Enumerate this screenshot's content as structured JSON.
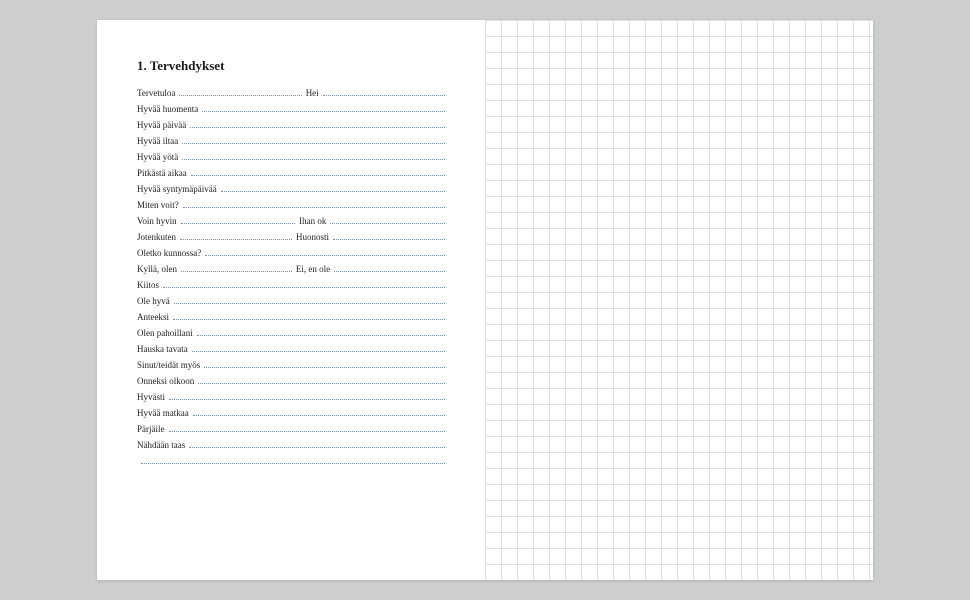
{
  "heading": "1. Tervehdykset",
  "rows": [
    {
      "cols": [
        {
          "w": "Tervetuloa"
        },
        {
          "w": "Hei"
        }
      ]
    },
    {
      "cols": [
        {
          "w": "Hyvää huomenta"
        }
      ]
    },
    {
      "cols": [
        {
          "w": "Hyvää päivää"
        }
      ]
    },
    {
      "cols": [
        {
          "w": "Hyvää iltaa"
        }
      ]
    },
    {
      "cols": [
        {
          "w": "Hyvää yötä"
        }
      ]
    },
    {
      "cols": [
        {
          "w": "Pitkästä aikaa"
        }
      ]
    },
    {
      "cols": [
        {
          "w": "Hyvää syntymäpäivää"
        }
      ]
    },
    {
      "cols": [
        {
          "w": "Miten voit?"
        }
      ]
    },
    {
      "cols": [
        {
          "w": "Voin hyvin"
        },
        {
          "w": "Ihan ok"
        }
      ]
    },
    {
      "cols": [
        {
          "w": "Jotenkuten"
        },
        {
          "w": "Huonosti"
        }
      ]
    },
    {
      "cols": [
        {
          "w": "Oletko kunnossa?"
        }
      ]
    },
    {
      "cols": [
        {
          "w": "Kyllä, olen"
        },
        {
          "w": "Ei, en ole"
        }
      ]
    },
    {
      "cols": [
        {
          "w": "Kiitos"
        }
      ]
    },
    {
      "cols": [
        {
          "w": "Ole hyvä"
        }
      ]
    },
    {
      "cols": [
        {
          "w": "Anteeksi"
        }
      ]
    },
    {
      "cols": [
        {
          "w": "Olen pahoillani"
        }
      ]
    },
    {
      "cols": [
        {
          "w": "Hauska tavata"
        }
      ]
    },
    {
      "cols": [
        {
          "w": "Sinut/teidät myös"
        }
      ]
    },
    {
      "cols": [
        {
          "w": "Onneksi olkoon"
        }
      ]
    },
    {
      "cols": [
        {
          "w": "Hyvästi"
        }
      ]
    },
    {
      "cols": [
        {
          "w": "Hyvää matkaa"
        }
      ]
    },
    {
      "cols": [
        {
          "w": "Pärjäile"
        }
      ]
    },
    {
      "cols": [
        {
          "w": "Nähdään taas"
        }
      ]
    },
    {
      "cols": [
        {
          "w": ""
        }
      ]
    }
  ]
}
